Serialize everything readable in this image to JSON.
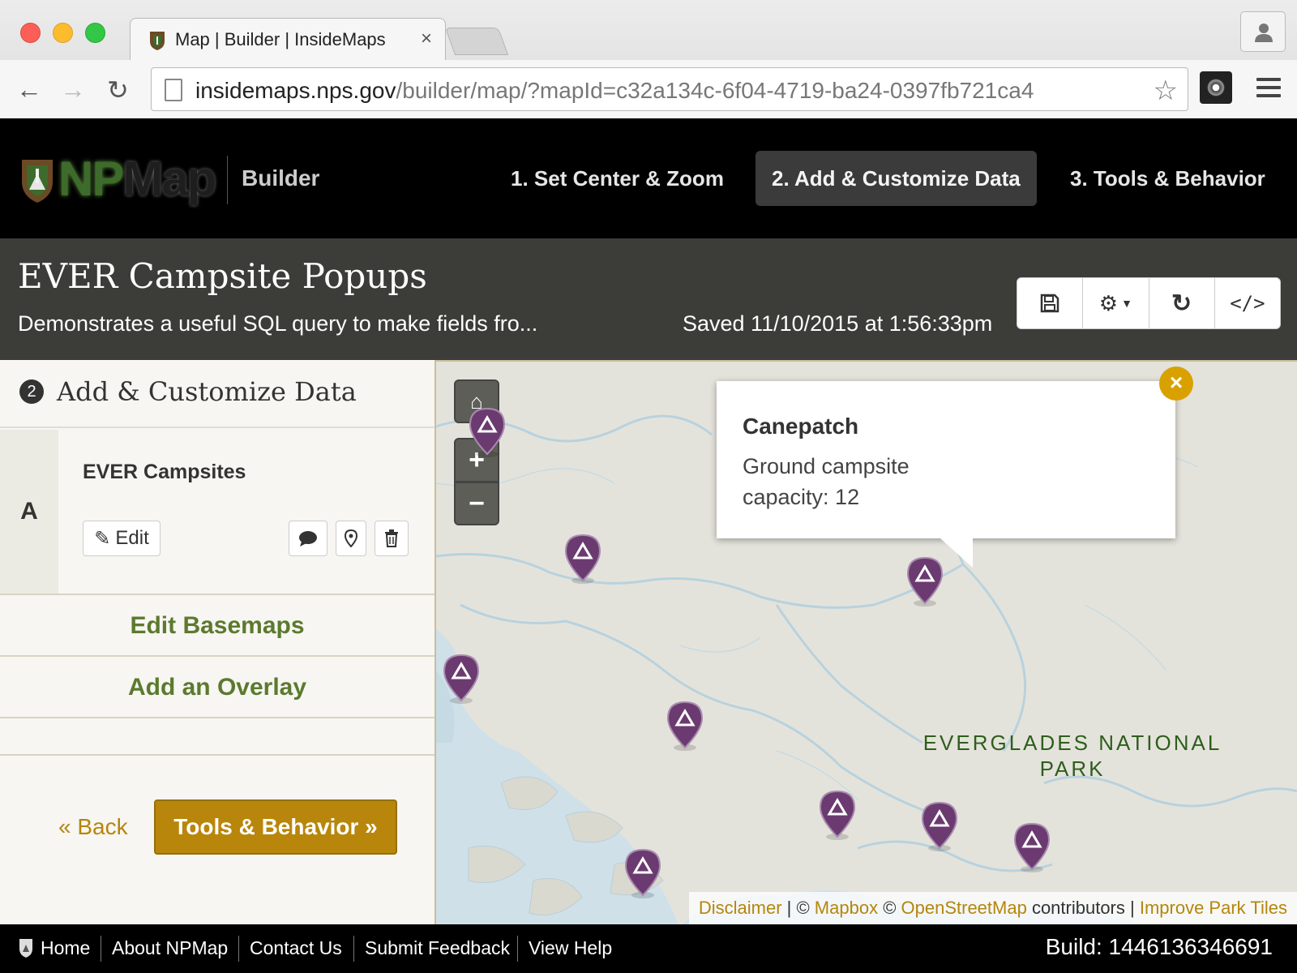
{
  "browser": {
    "tab_title": "Map | Builder | InsideMaps",
    "tab_close": "×",
    "url_host": "insidemaps.nps.gov",
    "url_path": "/builder/map/?mapId=c32a134c-6f04-4719-ba24-0397fb721ca4"
  },
  "header": {
    "logo_np": "NP",
    "logo_map": "Map",
    "builder_label": "Builder",
    "steps": [
      {
        "label": "1. Set Center & Zoom",
        "active": false
      },
      {
        "label": "2. Add & Customize Data",
        "active": true
      },
      {
        "label": "3. Tools & Behavior",
        "active": false
      }
    ]
  },
  "title_bar": {
    "title": "EVER Campsite Popups",
    "description": "Demonstrates a useful SQL query to make fields fro...",
    "saved": "Saved 11/10/2015 at 1:56:33pm"
  },
  "sidebar": {
    "step_number": "2",
    "heading": "Add & Customize Data",
    "layer": {
      "letter": "A",
      "name": "EVER Campsites",
      "edit_label": "Edit"
    },
    "edit_basemaps": "Edit Basemaps",
    "add_overlay": "Add an Overlay",
    "back": "« Back",
    "next": "Tools & Behavior »"
  },
  "map": {
    "popup": {
      "title": "Canepatch",
      "line1": "Ground campsite",
      "line2": "capacity: 12",
      "close": "×"
    },
    "park_label_line1": "EVERGLADES NATIONAL",
    "park_label_line2": "PARK",
    "attribution": {
      "disclaimer": "Disclaimer",
      "sep1": " | © ",
      "mapbox": "Mapbox",
      "sep2": " © ",
      "osm": "OpenStreetMap",
      "contributors": " contributors | ",
      "improve": "Improve Park Tiles"
    },
    "marker_color": "#6b3a70"
  },
  "footer": {
    "home": "Home",
    "about": "About NPMap",
    "contact": "Contact Us",
    "feedback": "Submit Feedback",
    "help": "View Help",
    "build": "Build: 1446136346691"
  },
  "colors": {
    "accent_gold": "#b8860b",
    "link_green": "#5b7a2e",
    "title_bar": "#3c3c38"
  }
}
